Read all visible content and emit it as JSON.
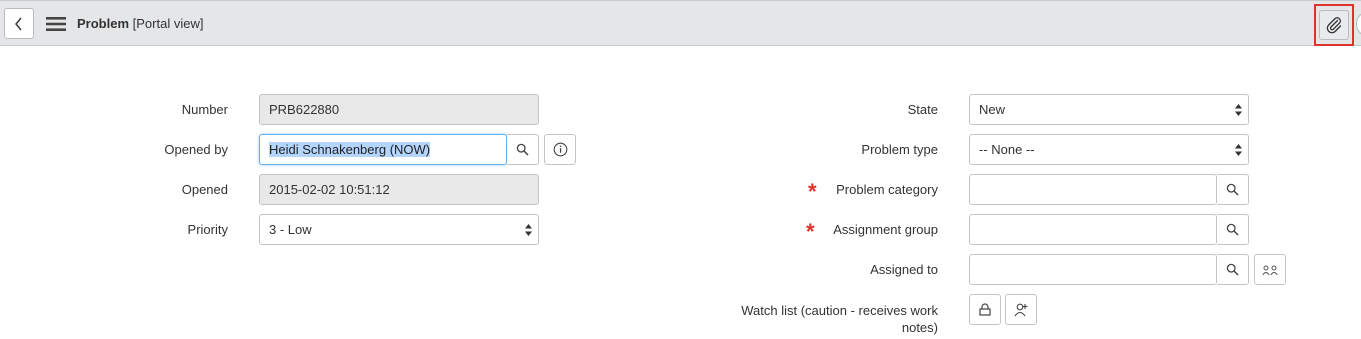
{
  "header": {
    "title": "Problem",
    "subtitle": "[Portal view]",
    "icons": {
      "back": "chevron-left-icon",
      "menu": "hamburger-menu-icon",
      "attachment": "paperclip-icon"
    }
  },
  "form": {
    "left": {
      "number": {
        "label": "Number",
        "value": "PRB622880"
      },
      "opened_by": {
        "label": "Opened by",
        "value": "Heidi Schnakenberg (NOW)"
      },
      "opened": {
        "label": "Opened",
        "value": "2015-02-02 10:51:12"
      },
      "priority": {
        "label": "Priority",
        "value": "3 - Low"
      }
    },
    "right": {
      "state": {
        "label": "State",
        "value": "New"
      },
      "problem_type": {
        "label": "Problem type",
        "value": "-- None --"
      },
      "problem_category": {
        "label": "Problem category",
        "value": "",
        "required_mark": "*"
      },
      "assignment_group": {
        "label": "Assignment group",
        "value": "",
        "required_mark": "*"
      },
      "assigned_to": {
        "label": "Assigned to",
        "value": ""
      },
      "watch_list": {
        "label_line1": "Watch list (caution - receives work",
        "label_line2": "notes)"
      }
    }
  },
  "colors": {
    "header_bg": "#e5e6e8",
    "required": "#e0312a",
    "highlight_border": "#e0312a",
    "focus_border": "#66afe9"
  }
}
